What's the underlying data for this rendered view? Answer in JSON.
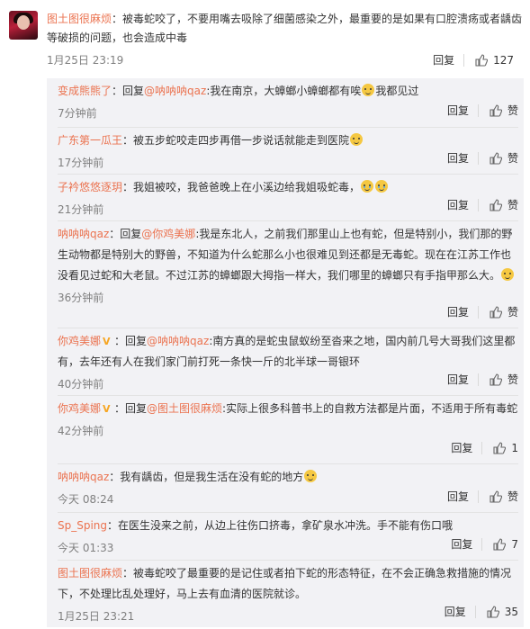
{
  "main": {
    "username": "图土图很麻烦",
    "text": "：被毒蛇咬了，不要用嘴去吸除了细菌感染之外，最重要的是如果有口腔溃疡或者龋齿等破损的问题，也会造成中毒",
    "time": "1月25日 23:19",
    "reply": "回复",
    "likes": "127"
  },
  "replies": [
    {
      "user": "变成熊熊了",
      "verified": false,
      "text": "：回复",
      "mention": "@呐呐呐qaz",
      "rest": ":我在南京，大蟑螂小蟑螂都有唉",
      "emoji": "dog",
      "tail": "我都见过",
      "time": "7分钟前",
      "reply": "回复",
      "likes": "赞"
    },
    {
      "user": "广东第一瓜王",
      "verified": false,
      "text": "：被五步蛇咬走四步再借一步说话就能走到医院",
      "mention": "",
      "rest": "",
      "emoji": "dog",
      "tail": "",
      "time": "17分钟前",
      "reply": "回复",
      "likes": "赞"
    },
    {
      "user": "子衿悠悠逐玥",
      "verified": false,
      "text": "：我姐被咬，我爸爸晚上在小溪边给我姐吸蛇毒，",
      "mention": "",
      "rest": "",
      "emoji": "cry2",
      "tail": "",
      "time": "21分钟前",
      "reply": "回复",
      "likes": "赞"
    },
    {
      "user": "呐呐呐qaz",
      "verified": false,
      "text": "：回复",
      "mention": "@你鸡美娜",
      "rest": ":我是东北人，之前我们那里山上也有蛇，但是特别小，我们那的野生动物都是特别大的野兽，不知道为什么蛇那么小也很难见到还都是无毒蛇。现在在江苏工作也没看见过蛇和大老鼠。不过江苏的蟑螂跟大拇指一样大，我们哪里的蟑螂只有手指甲那么大。",
      "emoji": "dog",
      "tail": "",
      "time": "36分钟前",
      "reply": "回复",
      "likes": "赞"
    },
    {
      "user": "你鸡美娜",
      "verified": true,
      "text": "：回复",
      "mention": "@呐呐呐qaz",
      "rest": ":南方真的是蛇虫鼠蚁纷至沓来之地，国内前几号大哥我们这里都有，去年还有人在我们家门前打死一条快一斤的北半球一哥银环",
      "emoji": "",
      "tail": "",
      "time": "40分钟前",
      "reply": "回复",
      "likes": "赞"
    },
    {
      "user": "你鸡美娜",
      "verified": true,
      "text": "：回复",
      "mention": "@图土图很麻烦",
      "rest": ":实际上很多科普书上的自救方法都是片面，不适用于所有毒蛇",
      "emoji": "",
      "tail": "",
      "time": "42分钟前",
      "reply": "回复",
      "likes": "1"
    },
    {
      "user": "呐呐呐qaz",
      "verified": false,
      "text": "：我有龋齿，但是我生活在没有蛇的地方",
      "mention": "",
      "rest": "",
      "emoji": "dog",
      "tail": "",
      "time": "今天 08:24",
      "reply": "回复",
      "likes": "赞"
    },
    {
      "user": "Sp_Sping",
      "verified": false,
      "text": "：在医生没来之前，从边上往伤口挤毒，拿矿泉水冲洗。手不能有伤口哦",
      "mention": "",
      "rest": "",
      "emoji": "",
      "tail": "",
      "time": "今天 01:33",
      "reply": "回复",
      "likes": "7"
    },
    {
      "user": "图土图很麻烦",
      "verified": false,
      "text": "：被毒蛇咬了最重要的是记住或者拍下蛇的形态特征，在不会正确急救措施的情况下，不处理比乱处理好，马上去有血清的医院就诊。",
      "mention": "",
      "rest": "",
      "emoji": "",
      "tail": "",
      "time": "1月25日 23:21",
      "reply": "回复",
      "likes": "35"
    }
  ],
  "colors": {
    "username": "#eb7350",
    "mention": "#eb7350",
    "subBg": "#f2f2f5"
  },
  "icons": {
    "like": "thumbs-up-icon",
    "verified": "verified-badge-icon",
    "emoji": "dog-face-emoji"
  }
}
